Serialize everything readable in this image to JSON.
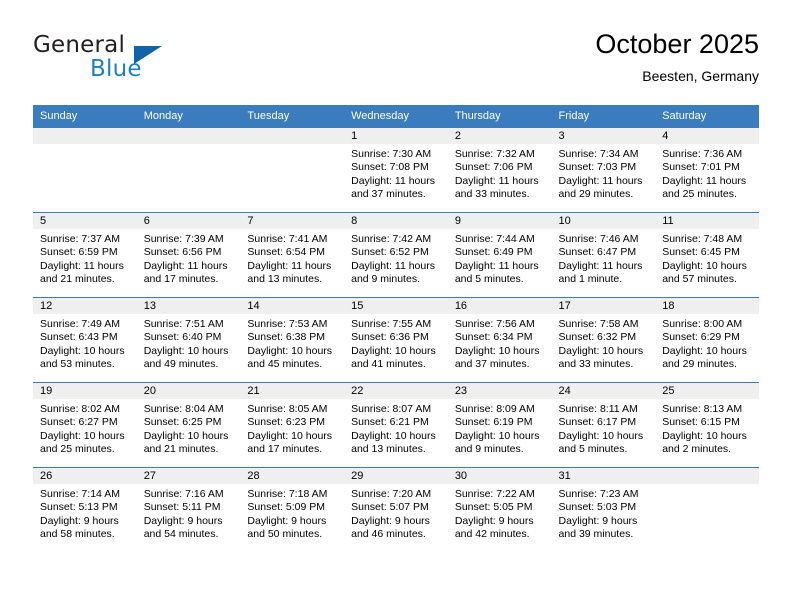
{
  "brand": {
    "name_top": "General",
    "name_bottom": "Blue",
    "triangle_color": "#1164a8",
    "blue_color": "#1f7fc4"
  },
  "header": {
    "month_title": "October 2025",
    "location": "Beesten, Germany"
  },
  "theme": {
    "header_blue": "#3a7cbe",
    "daynum_bg": "#efefef"
  },
  "weekday_headers": [
    "Sunday",
    "Monday",
    "Tuesday",
    "Wednesday",
    "Thursday",
    "Friday",
    "Saturday"
  ],
  "weeks": [
    [
      {
        "empty": true,
        "day": "",
        "sunrise": "",
        "sunset": "",
        "daylight_line1": "",
        "daylight_line2": ""
      },
      {
        "empty": true,
        "day": "",
        "sunrise": "",
        "sunset": "",
        "daylight_line1": "",
        "daylight_line2": ""
      },
      {
        "empty": true,
        "day": "",
        "sunrise": "",
        "sunset": "",
        "daylight_line1": "",
        "daylight_line2": ""
      },
      {
        "empty": false,
        "day": "1",
        "sunrise": "Sunrise: 7:30 AM",
        "sunset": "Sunset: 7:08 PM",
        "daylight_line1": "Daylight: 11 hours",
        "daylight_line2": "and 37 minutes."
      },
      {
        "empty": false,
        "day": "2",
        "sunrise": "Sunrise: 7:32 AM",
        "sunset": "Sunset: 7:06 PM",
        "daylight_line1": "Daylight: 11 hours",
        "daylight_line2": "and 33 minutes."
      },
      {
        "empty": false,
        "day": "3",
        "sunrise": "Sunrise: 7:34 AM",
        "sunset": "Sunset: 7:03 PM",
        "daylight_line1": "Daylight: 11 hours",
        "daylight_line2": "and 29 minutes."
      },
      {
        "empty": false,
        "day": "4",
        "sunrise": "Sunrise: 7:36 AM",
        "sunset": "Sunset: 7:01 PM",
        "daylight_line1": "Daylight: 11 hours",
        "daylight_line2": "and 25 minutes."
      }
    ],
    [
      {
        "empty": false,
        "day": "5",
        "sunrise": "Sunrise: 7:37 AM",
        "sunset": "Sunset: 6:59 PM",
        "daylight_line1": "Daylight: 11 hours",
        "daylight_line2": "and 21 minutes."
      },
      {
        "empty": false,
        "day": "6",
        "sunrise": "Sunrise: 7:39 AM",
        "sunset": "Sunset: 6:56 PM",
        "daylight_line1": "Daylight: 11 hours",
        "daylight_line2": "and 17 minutes."
      },
      {
        "empty": false,
        "day": "7",
        "sunrise": "Sunrise: 7:41 AM",
        "sunset": "Sunset: 6:54 PM",
        "daylight_line1": "Daylight: 11 hours",
        "daylight_line2": "and 13 minutes."
      },
      {
        "empty": false,
        "day": "8",
        "sunrise": "Sunrise: 7:42 AM",
        "sunset": "Sunset: 6:52 PM",
        "daylight_line1": "Daylight: 11 hours",
        "daylight_line2": "and 9 minutes."
      },
      {
        "empty": false,
        "day": "9",
        "sunrise": "Sunrise: 7:44 AM",
        "sunset": "Sunset: 6:49 PM",
        "daylight_line1": "Daylight: 11 hours",
        "daylight_line2": "and 5 minutes."
      },
      {
        "empty": false,
        "day": "10",
        "sunrise": "Sunrise: 7:46 AM",
        "sunset": "Sunset: 6:47 PM",
        "daylight_line1": "Daylight: 11 hours",
        "daylight_line2": "and 1 minute."
      },
      {
        "empty": false,
        "day": "11",
        "sunrise": "Sunrise: 7:48 AM",
        "sunset": "Sunset: 6:45 PM",
        "daylight_line1": "Daylight: 10 hours",
        "daylight_line2": "and 57 minutes."
      }
    ],
    [
      {
        "empty": false,
        "day": "12",
        "sunrise": "Sunrise: 7:49 AM",
        "sunset": "Sunset: 6:43 PM",
        "daylight_line1": "Daylight: 10 hours",
        "daylight_line2": "and 53 minutes."
      },
      {
        "empty": false,
        "day": "13",
        "sunrise": "Sunrise: 7:51 AM",
        "sunset": "Sunset: 6:40 PM",
        "daylight_line1": "Daylight: 10 hours",
        "daylight_line2": "and 49 minutes."
      },
      {
        "empty": false,
        "day": "14",
        "sunrise": "Sunrise: 7:53 AM",
        "sunset": "Sunset: 6:38 PM",
        "daylight_line1": "Daylight: 10 hours",
        "daylight_line2": "and 45 minutes."
      },
      {
        "empty": false,
        "day": "15",
        "sunrise": "Sunrise: 7:55 AM",
        "sunset": "Sunset: 6:36 PM",
        "daylight_line1": "Daylight: 10 hours",
        "daylight_line2": "and 41 minutes."
      },
      {
        "empty": false,
        "day": "16",
        "sunrise": "Sunrise: 7:56 AM",
        "sunset": "Sunset: 6:34 PM",
        "daylight_line1": "Daylight: 10 hours",
        "daylight_line2": "and 37 minutes."
      },
      {
        "empty": false,
        "day": "17",
        "sunrise": "Sunrise: 7:58 AM",
        "sunset": "Sunset: 6:32 PM",
        "daylight_line1": "Daylight: 10 hours",
        "daylight_line2": "and 33 minutes."
      },
      {
        "empty": false,
        "day": "18",
        "sunrise": "Sunrise: 8:00 AM",
        "sunset": "Sunset: 6:29 PM",
        "daylight_line1": "Daylight: 10 hours",
        "daylight_line2": "and 29 minutes."
      }
    ],
    [
      {
        "empty": false,
        "day": "19",
        "sunrise": "Sunrise: 8:02 AM",
        "sunset": "Sunset: 6:27 PM",
        "daylight_line1": "Daylight: 10 hours",
        "daylight_line2": "and 25 minutes."
      },
      {
        "empty": false,
        "day": "20",
        "sunrise": "Sunrise: 8:04 AM",
        "sunset": "Sunset: 6:25 PM",
        "daylight_line1": "Daylight: 10 hours",
        "daylight_line2": "and 21 minutes."
      },
      {
        "empty": false,
        "day": "21",
        "sunrise": "Sunrise: 8:05 AM",
        "sunset": "Sunset: 6:23 PM",
        "daylight_line1": "Daylight: 10 hours",
        "daylight_line2": "and 17 minutes."
      },
      {
        "empty": false,
        "day": "22",
        "sunrise": "Sunrise: 8:07 AM",
        "sunset": "Sunset: 6:21 PM",
        "daylight_line1": "Daylight: 10 hours",
        "daylight_line2": "and 13 minutes."
      },
      {
        "empty": false,
        "day": "23",
        "sunrise": "Sunrise: 8:09 AM",
        "sunset": "Sunset: 6:19 PM",
        "daylight_line1": "Daylight: 10 hours",
        "daylight_line2": "and 9 minutes."
      },
      {
        "empty": false,
        "day": "24",
        "sunrise": "Sunrise: 8:11 AM",
        "sunset": "Sunset: 6:17 PM",
        "daylight_line1": "Daylight: 10 hours",
        "daylight_line2": "and 5 minutes."
      },
      {
        "empty": false,
        "day": "25",
        "sunrise": "Sunrise: 8:13 AM",
        "sunset": "Sunset: 6:15 PM",
        "daylight_line1": "Daylight: 10 hours",
        "daylight_line2": "and 2 minutes."
      }
    ],
    [
      {
        "empty": false,
        "day": "26",
        "sunrise": "Sunrise: 7:14 AM",
        "sunset": "Sunset: 5:13 PM",
        "daylight_line1": "Daylight: 9 hours",
        "daylight_line2": "and 58 minutes."
      },
      {
        "empty": false,
        "day": "27",
        "sunrise": "Sunrise: 7:16 AM",
        "sunset": "Sunset: 5:11 PM",
        "daylight_line1": "Daylight: 9 hours",
        "daylight_line2": "and 54 minutes."
      },
      {
        "empty": false,
        "day": "28",
        "sunrise": "Sunrise: 7:18 AM",
        "sunset": "Sunset: 5:09 PM",
        "daylight_line1": "Daylight: 9 hours",
        "daylight_line2": "and 50 minutes."
      },
      {
        "empty": false,
        "day": "29",
        "sunrise": "Sunrise: 7:20 AM",
        "sunset": "Sunset: 5:07 PM",
        "daylight_line1": "Daylight: 9 hours",
        "daylight_line2": "and 46 minutes."
      },
      {
        "empty": false,
        "day": "30",
        "sunrise": "Sunrise: 7:22 AM",
        "sunset": "Sunset: 5:05 PM",
        "daylight_line1": "Daylight: 9 hours",
        "daylight_line2": "and 42 minutes."
      },
      {
        "empty": false,
        "day": "31",
        "sunrise": "Sunrise: 7:23 AM",
        "sunset": "Sunset: 5:03 PM",
        "daylight_line1": "Daylight: 9 hours",
        "daylight_line2": "and 39 minutes."
      },
      {
        "empty": true,
        "day": "",
        "sunrise": "",
        "sunset": "",
        "daylight_line1": "",
        "daylight_line2": ""
      }
    ]
  ]
}
